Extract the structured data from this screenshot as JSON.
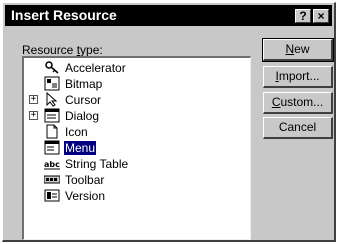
{
  "window": {
    "title": "Insert Resource",
    "help_glyph": "?",
    "close_glyph": "×"
  },
  "resource_type_label": {
    "prefix": "Resource ",
    "accel": "t",
    "suffix": "ype:"
  },
  "tree": {
    "items": [
      {
        "label": "Accelerator",
        "icon": "accelerator-icon",
        "expandable": false,
        "selected": false
      },
      {
        "label": "Bitmap",
        "icon": "bitmap-icon",
        "expandable": false,
        "selected": false
      },
      {
        "label": "Cursor",
        "icon": "cursor-icon",
        "expandable": true,
        "selected": false
      },
      {
        "label": "Dialog",
        "icon": "dialog-icon",
        "expandable": true,
        "selected": false
      },
      {
        "label": "Icon",
        "icon": "icon-resource-icon",
        "expandable": false,
        "selected": false
      },
      {
        "label": "Menu",
        "icon": "menu-icon",
        "expandable": false,
        "selected": true
      },
      {
        "label": "String Table",
        "icon": "string-table-icon",
        "expandable": false,
        "selected": false
      },
      {
        "label": "Toolbar",
        "icon": "toolbar-icon",
        "expandable": false,
        "selected": false
      },
      {
        "label": "Version",
        "icon": "version-icon",
        "expandable": false,
        "selected": false
      }
    ],
    "expander_glyph": "+"
  },
  "buttons": {
    "new": {
      "accel": "N",
      "rest": "ew"
    },
    "import": {
      "accel": "I",
      "rest": "mport..."
    },
    "custom": {
      "accel": "C",
      "rest": "ustom..."
    },
    "cancel": {
      "label": "Cancel"
    }
  },
  "colors": {
    "dialog_bg": "#c8c8c8",
    "titlebar_bg": "#000000",
    "selection_bg": "#000080"
  }
}
